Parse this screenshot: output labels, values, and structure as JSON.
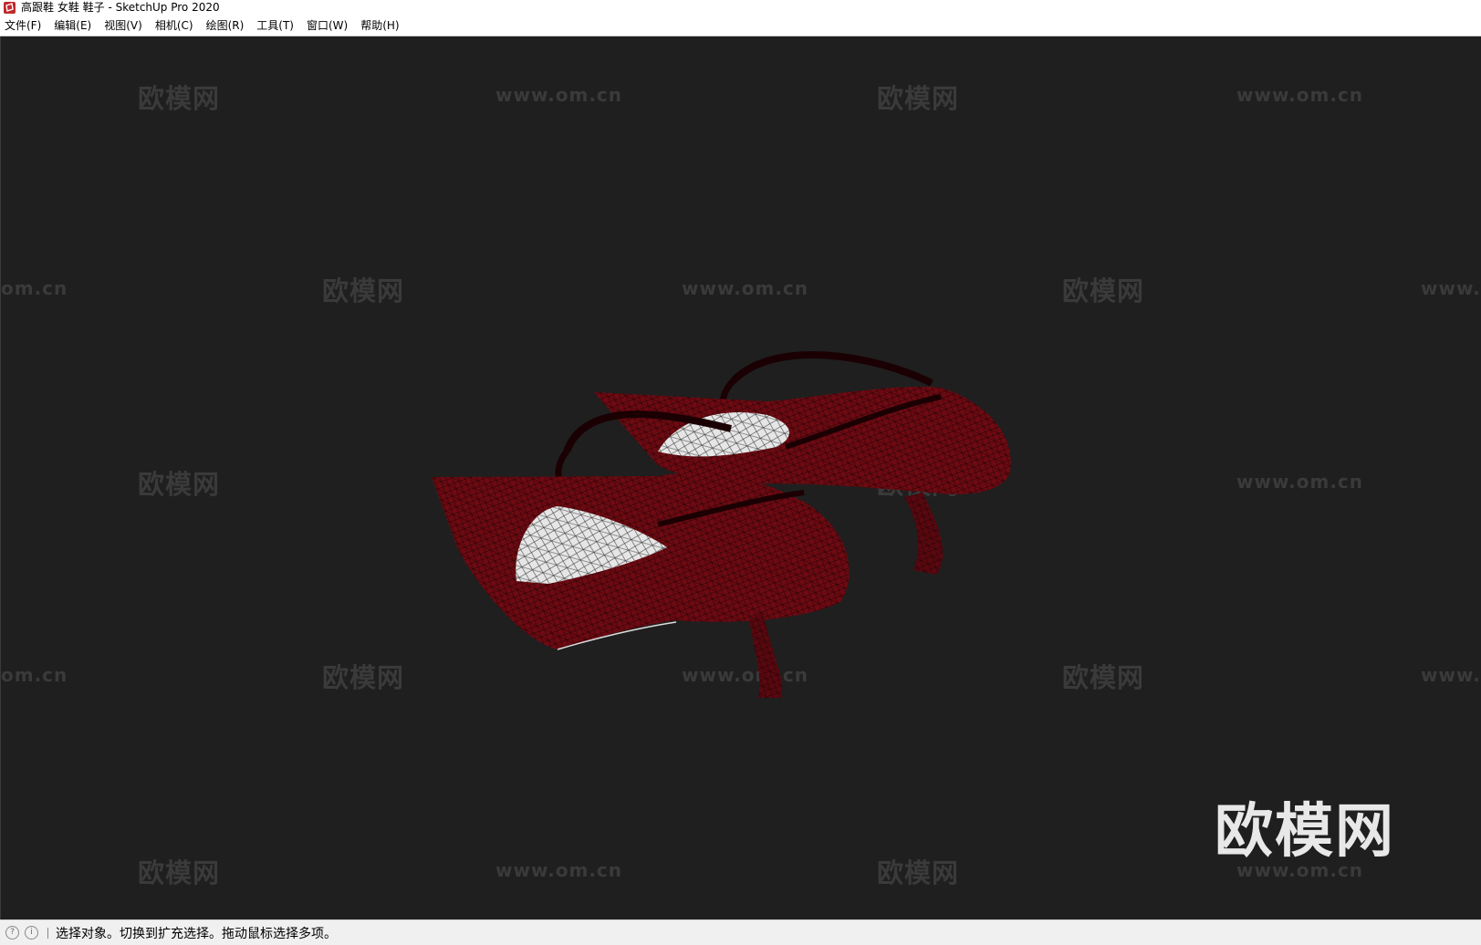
{
  "window": {
    "title": "高跟鞋 女鞋 鞋子 - SketchUp Pro 2020",
    "app_icon": "sketchup-icon"
  },
  "menubar": {
    "items": [
      "文件(F)",
      "编辑(E)",
      "视图(V)",
      "相机(C)",
      "绘图(R)",
      "工具(T)",
      "窗口(W)",
      "帮助(H)"
    ]
  },
  "viewport": {
    "background": "#1f1f1f",
    "model": "red-high-heel-shoes-wireframe",
    "watermarks": {
      "brand": "欧模网",
      "url": "www.om.cn",
      "url_fragment_left": "om.cn",
      "url_fragment_right": "www."
    },
    "brand_logo": "欧模网"
  },
  "statusbar": {
    "icons": [
      "geo-location-icon",
      "info-icon"
    ],
    "text": "选择对象。切换到扩充选择。拖动鼠标选择多项。"
  },
  "colors": {
    "shoe_red": "#6e0a12",
    "shoe_dark": "#3a0508",
    "insole": "#e6e6e6"
  }
}
